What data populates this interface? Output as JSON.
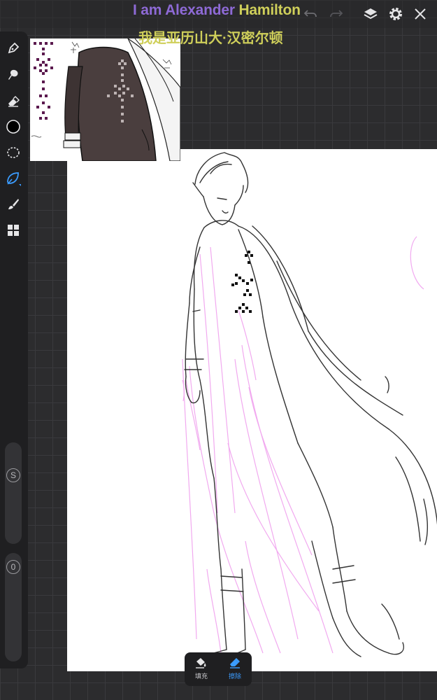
{
  "caption": {
    "english_part1": "I am Alexander",
    "english_part2": " Hamilton",
    "chinese": "我是亚历山大·汉密尔顿"
  },
  "topbar": {
    "icons": [
      "undo-icon",
      "redo-icon",
      "layers-icon",
      "settings-icon",
      "close-icon"
    ]
  },
  "toolbar": {
    "tools": [
      "pen-icon",
      "smudge-icon",
      "eraser-icon",
      "color-swatch",
      "lasso-icon",
      "leaf-shape-icon",
      "brush-icon",
      "apps-grid-icon"
    ],
    "active_tool": "leaf-shape-icon",
    "size_slider_label": "S",
    "opacity_slider_label": "0"
  },
  "popup": {
    "fill_label": "填充",
    "erase_label": "擦除",
    "active": "erase"
  },
  "colors": {
    "accent": "#3b9cff",
    "caption_purple": "#8e6ad6",
    "caption_yellow": "#cfcf5a",
    "current_color": "#000000",
    "guide_sketch": "#f0a0ee"
  }
}
